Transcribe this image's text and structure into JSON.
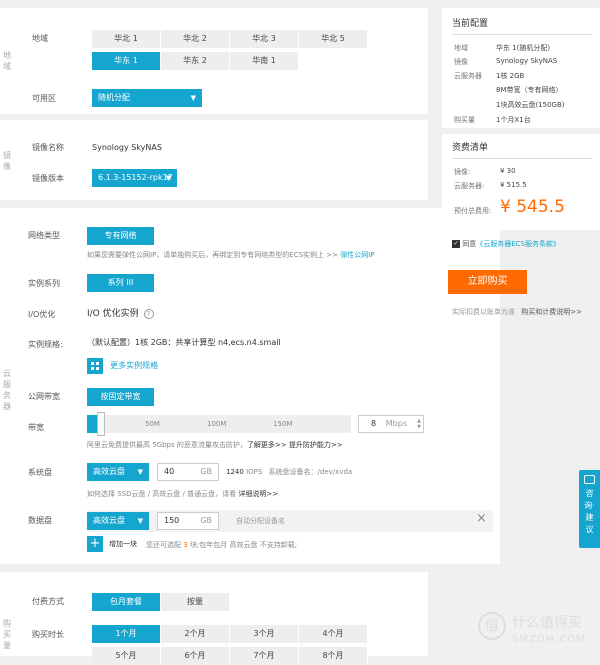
{
  "region": {
    "vlabel": "地域",
    "label": "地域",
    "row1": [
      "华北 1",
      "华北 2",
      "华北 3",
      "华北 5"
    ],
    "row2": [
      "华东 1",
      "华东 2",
      "华南 1"
    ],
    "selected": "华东 1",
    "zone_label": "可用区",
    "zone_value": "随机分配"
  },
  "image": {
    "vlabel": "镜像",
    "name_label": "镜像名称",
    "name_value": "Synology SkyNAS",
    "version_label": "镜像版本",
    "version_value": "6.1.3-15152-rpk17"
  },
  "instance": {
    "vlabel": "云服务器",
    "network_label": "网络类型",
    "network_value": "专有网络",
    "network_hint": "如果您需要弹性公网IP，请单独购买后，再绑定到专有网络类型的ECS实例上 >>",
    "network_hint_link": "弹性公网IP",
    "series_label": "实例系列",
    "series_value": "系列 III",
    "io_label": "I/O优化",
    "io_value": "I/O 优化实例",
    "io_help": "?",
    "spec_label": "实例规格:",
    "spec_value": "（默认配置）1核 2GB：共享计算型 n4,ecs.n4.small",
    "more_specs": "更多实例规格",
    "bw_type_label": "公网带宽",
    "bw_type_value": "按固定带宽",
    "bw_label": "带宽",
    "bw_ticks": [
      "50M",
      "100M",
      "150M"
    ],
    "bw_value": "8",
    "bw_unit": "Mbps",
    "bw_fraction": 0.04,
    "bw_hint": "阿里云免费提供最高 5Gbps 的恶意流量攻击防护，",
    "bw_hint_link": "了解更多>> 提升防护能力>>",
    "sysdisk_label": "系统盘",
    "sysdisk_type": "高效云盘",
    "sysdisk_size": "40",
    "sysdisk_unit": "GB",
    "sysdisk_iops": "1240",
    "sysdisk_iops_unit": "IOPS",
    "sysdisk_dev": "系统盘设备名：/dev/xvda",
    "sysdisk_hint": "如何选择 SSD云盘 / 高效云盘 / 普通云盘，请看",
    "sysdisk_hint_link": "详细说明>>",
    "datadisk_label": "数据盘",
    "datadisk_type": "高效云盘",
    "datadisk_size": "150",
    "datadisk_unit": "GB",
    "datadisk_auto": "自动分配设备名",
    "datadisk_remove": "×",
    "add_icon": "+",
    "add_label": "增加一块",
    "add_hint_pre": "您还可选配",
    "add_hint_num": "3",
    "add_hint_post": "块;包年包月 高效云盘 不支持卸载;"
  },
  "purchase": {
    "vlabel": "购买量",
    "pay_label": "付费方式",
    "pay_options": [
      "包月套餐",
      "按量"
    ],
    "pay_selected": "包月套餐",
    "duration_label": "购买时长",
    "durations": [
      "1个月",
      "2个月",
      "3个月",
      "4个月"
    ],
    "durations_row2": [
      "5个月",
      "6个月",
      "7个月",
      "8个月"
    ],
    "duration_selected": "1个月"
  },
  "summary": {
    "title": "当前配置",
    "rows": [
      {
        "k": "地域",
        "v": "华东 1(随机分配)"
      },
      {
        "k": "镜像",
        "v": "Synology SkyNAS"
      },
      {
        "k": "云服务器",
        "v": "1核 2GB"
      },
      {
        "k": "",
        "v": "8M带宽（专有网络）"
      },
      {
        "k": "",
        "v": "1块高效云盘(150GB)"
      },
      {
        "k": "购买量",
        "v": "1个月X1台"
      }
    ],
    "cost_title": "资费清单",
    "cost_rows": [
      {
        "k": "镜像:",
        "v": "¥ 30"
      },
      {
        "k": "云服务器:",
        "v": "¥ 515.5"
      }
    ],
    "total_label": "预付总费用:",
    "total_value": "¥ 545.5",
    "agree_pre": "同意",
    "agree_link": "《云服务器ECS服务条款》",
    "buy_button": "立即购买",
    "footer_left": "实际扣费以账单为准",
    "footer_right": "购买和计费说明>>"
  },
  "side_tab": {
    "text": "咨询·建议"
  },
  "watermark": {
    "text": "什么值得买",
    "sub": "SMZDM.COM",
    "logo": "值"
  },
  "colors": {
    "accent": "#15a6cf",
    "orange": "#ff6a00",
    "price": "#ff6a00",
    "link": "#15a6cf"
  }
}
